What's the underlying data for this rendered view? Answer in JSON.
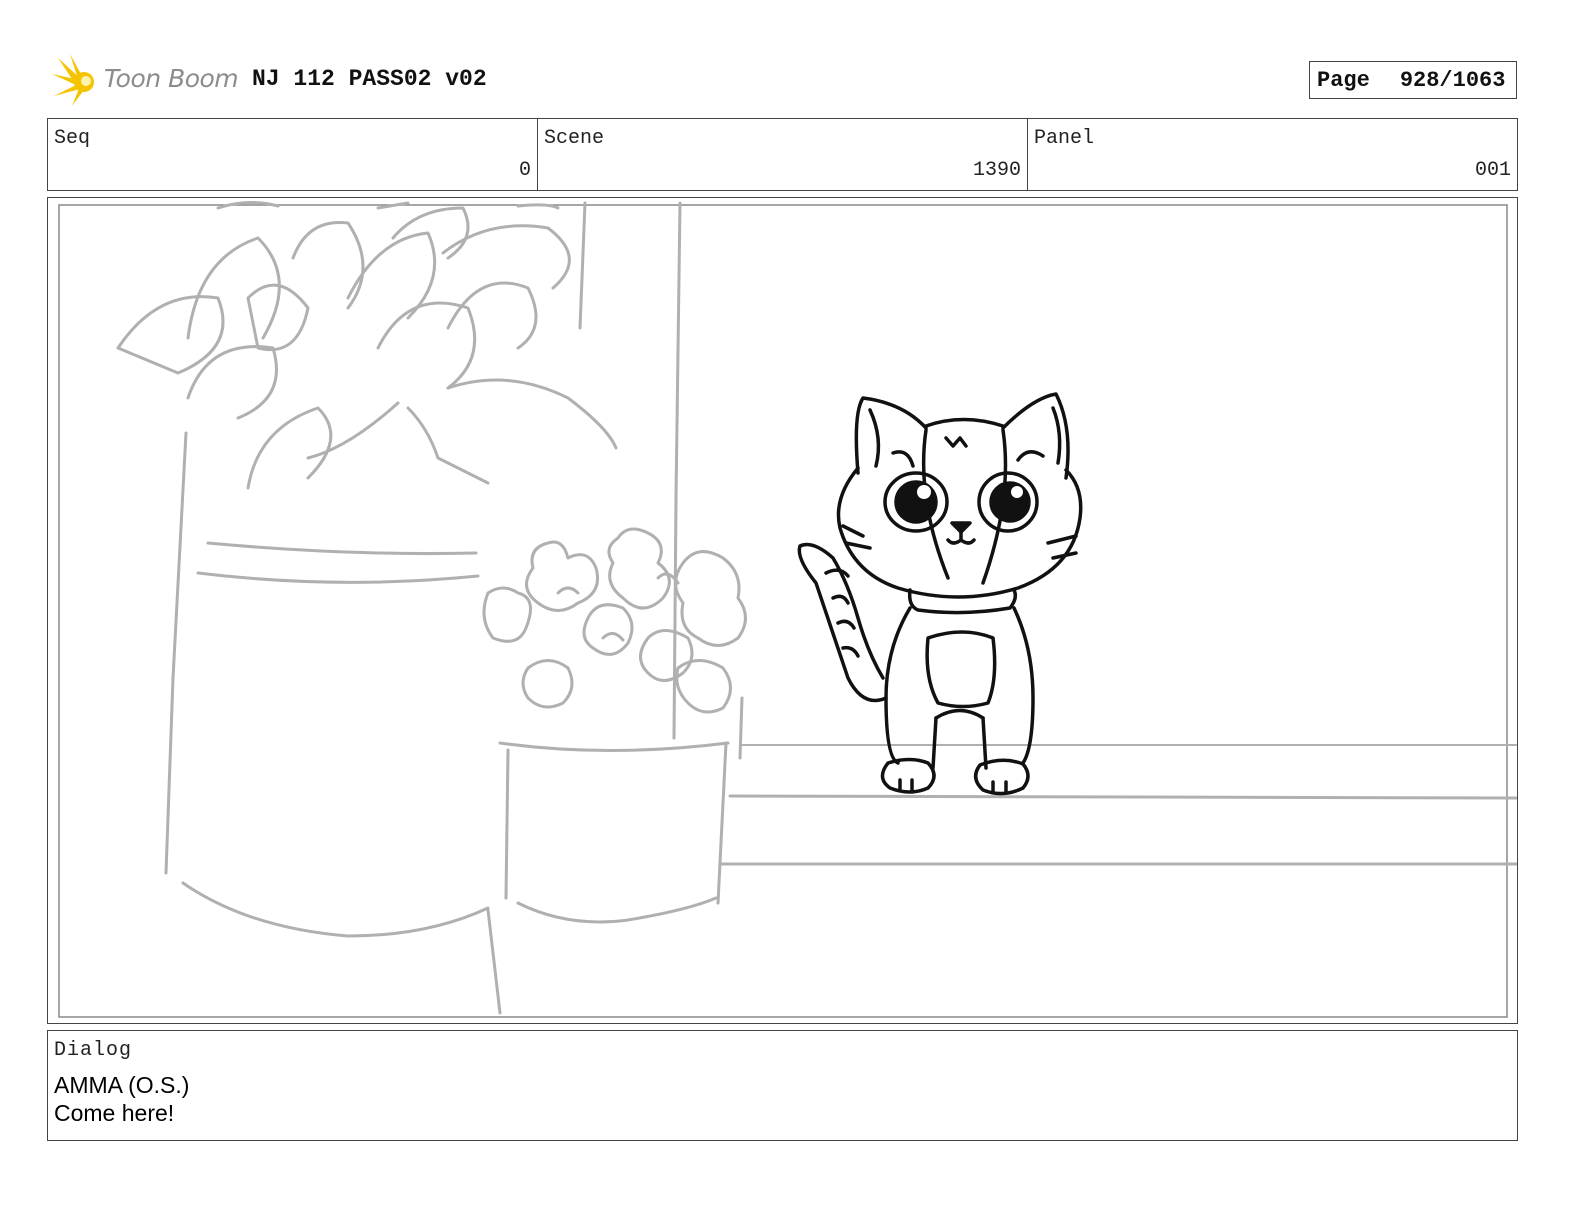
{
  "header": {
    "logo_text": "Toon Boom",
    "project_title": "NJ 112 PASS02 v02",
    "page_label": "Page",
    "page_number": "928/1063"
  },
  "info": {
    "seq": {
      "label": "Seq",
      "value": "0"
    },
    "scene": {
      "label": "Scene",
      "value": "1390"
    },
    "panel": {
      "label": "Panel",
      "value": "001"
    }
  },
  "drawing": {
    "icon": "storyboard-sketch",
    "subject": "cat sitting on windowsill beside potted plants",
    "colors": {
      "character_line": "#111111",
      "background_line": "#b0b0b0",
      "logo_star": "#f5c400"
    }
  },
  "dialog": {
    "label": "Dialog",
    "character": "AMMA (O.S.)",
    "line": "Come here!"
  }
}
